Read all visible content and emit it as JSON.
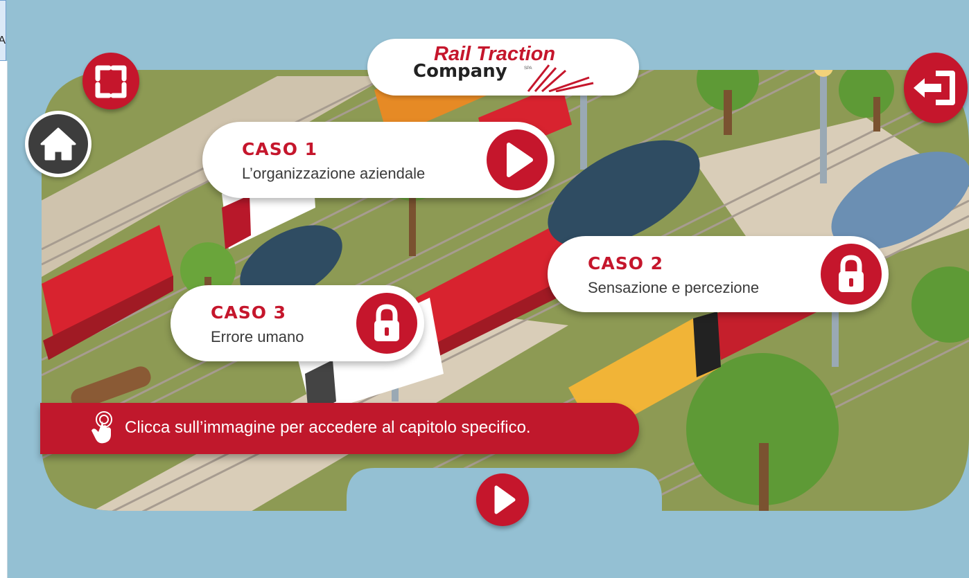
{
  "edge_letter": "A",
  "logo": {
    "line1": "Rail Traction",
    "line2": "Company",
    "suffix": "SPA"
  },
  "cases": [
    {
      "title": "CASO 1",
      "subtitle": "L’organizzazione aziendale",
      "action": "play-icon"
    },
    {
      "title": "CASO 2",
      "subtitle": "Sensazione e percezione",
      "action": "lock-icon"
    },
    {
      "title": "CASO 3",
      "subtitle": "Errore umano",
      "action": "lock-icon"
    }
  ],
  "banner": {
    "text": "Clicca sull’immagine per accedere al capitolo specifico.",
    "icon": "tap-hand-icon"
  },
  "icons": {
    "fullscreen": "fullscreen-icon",
    "home": "home-icon",
    "exit": "exit-icon",
    "next": "play-icon"
  },
  "colors": {
    "brand_red": "#c5162c",
    "background": "#94c0d3",
    "grass": "#8d9a54",
    "home_button": "#3d3d3d"
  }
}
